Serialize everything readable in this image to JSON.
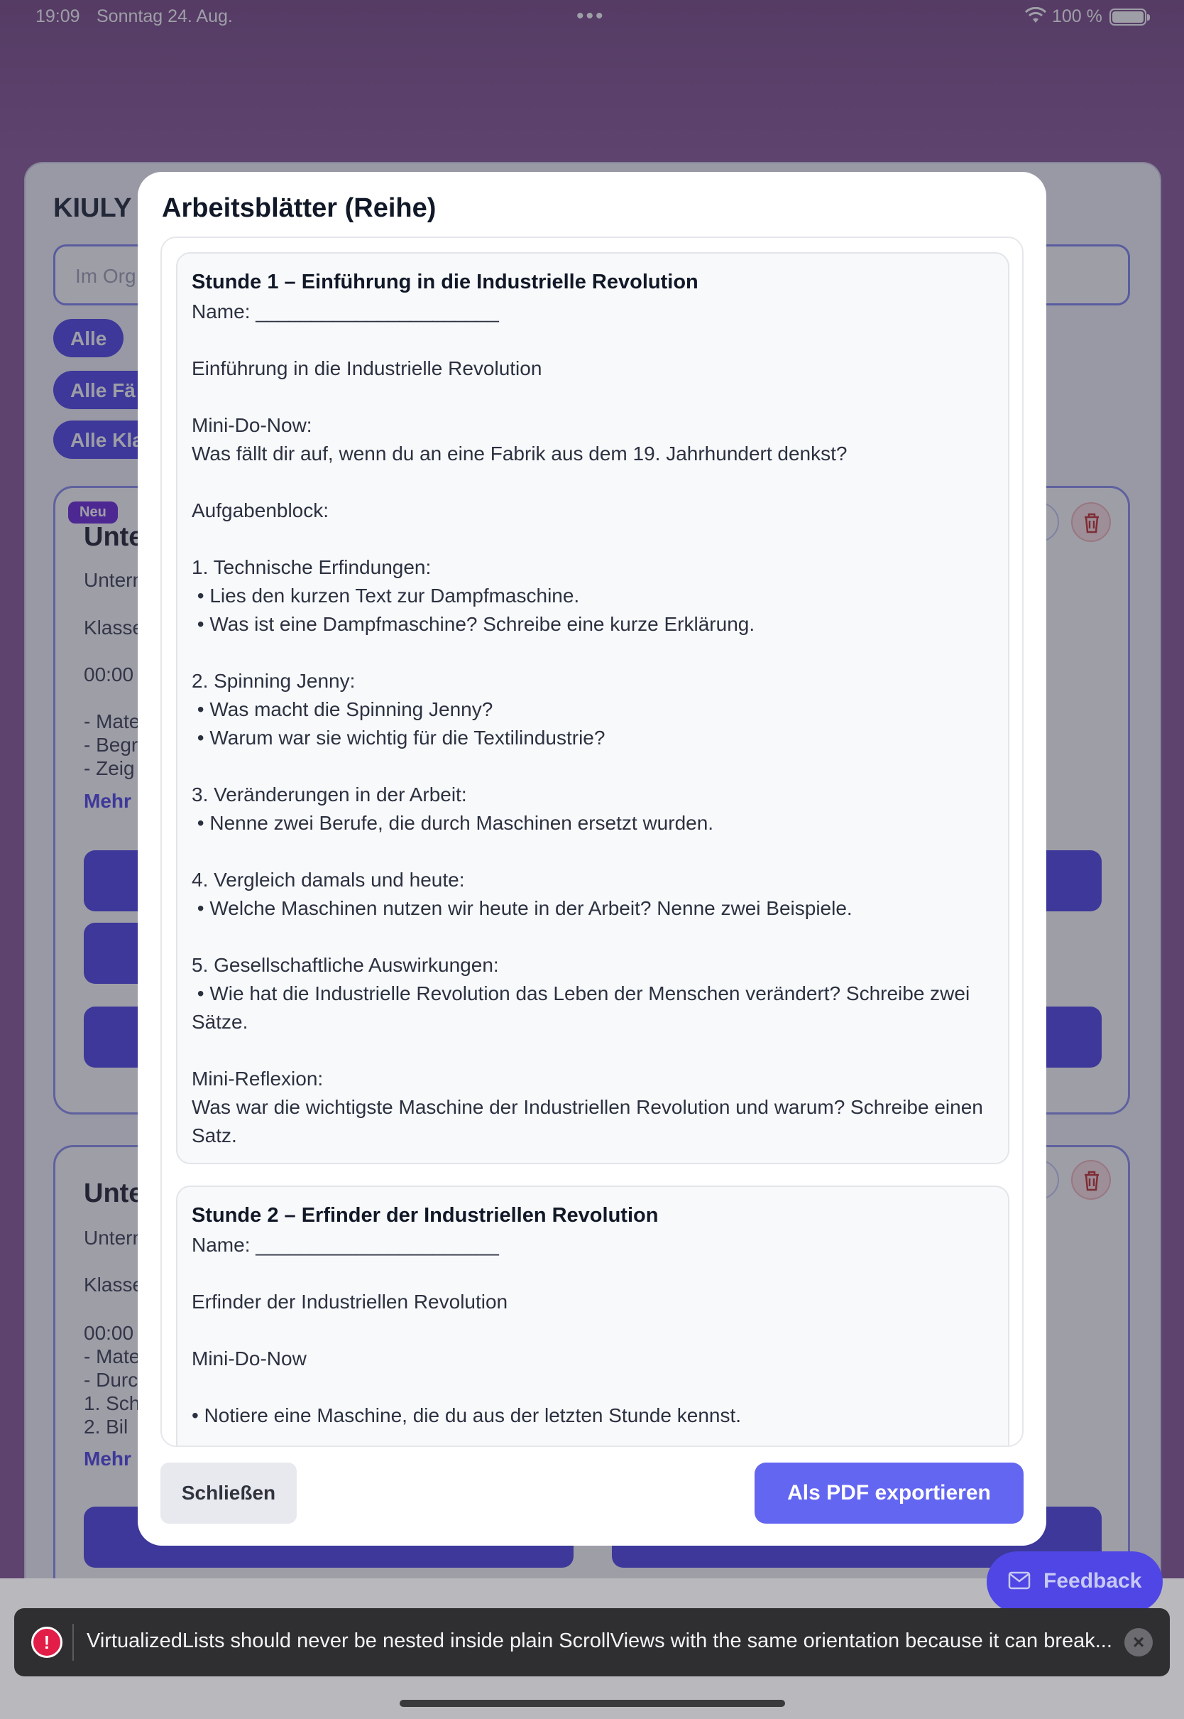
{
  "status_bar": {
    "time": "19:09",
    "date": "Sonntag 24. Aug.",
    "battery_pct": "100 %"
  },
  "background": {
    "app_title": "KIULY",
    "search_placeholder": "Im Org",
    "filters": [
      "Alle",
      "Alle Fä",
      "Alle Kla"
    ],
    "card1": {
      "badge": "Neu",
      "title": "Unte",
      "lines": [
        "Untern",
        "Klasse",
        "00:00",
        "- Mate",
        "- Begr",
        "- Zeig"
      ],
      "more": "Mehr"
    },
    "card2": {
      "title": "Unte",
      "lines": [
        "Untern",
        "Klasse",
        "00:00",
        "- Mate",
        "- Durc",
        " 1. Sch",
        " 2. Bil"
      ],
      "more": "Mehr"
    }
  },
  "modal": {
    "title": "Arbeitsblätter (Reihe)",
    "sheets": [
      {
        "title": "Stunde 1 – Einführung in die Industrielle Revolution",
        "body": "Name: ______________________\n\nEinführung in die Industrielle Revolution\n\nMini-Do-Now:\nWas fällt dir auf, wenn du an eine Fabrik aus dem 19. Jahrhundert denkst?\n\nAufgabenblock:\n\n1. Technische Erfindungen:\n • Lies den kurzen Text zur Dampfmaschine.\n • Was ist eine Dampfmaschine? Schreibe eine kurze Erklärung.\n\n2. Spinning Jenny:\n • Was macht die Spinning Jenny?\n • Warum war sie wichtig für die Textilindustrie?\n\n3. Veränderungen in der Arbeit:\n • Nenne zwei Berufe, die durch Maschinen ersetzt wurden.\n\n4. Vergleich damals und heute:\n • Welche Maschinen nutzen wir heute in der Arbeit? Nenne zwei Beispiele.\n\n5. Gesellschaftliche Auswirkungen:\n • Wie hat die Industrielle Revolution das Leben der Menschen verändert? Schreibe zwei Sätze.\n\nMini-Reflexion:\nWas war die wichtigste Maschine der Industriellen Revolution und warum? Schreibe einen Satz."
      },
      {
        "title": "Stunde 2 – Erfinder der Industriellen Revolution",
        "body": "Name: ______________________\n\nErfinder der Industriellen Revolution\n\nMini-Do-Now\n\n• Notiere eine Maschine, die du aus der letzten Stunde kennst."
      }
    ],
    "close_label": "Schließen",
    "export_label": "Als PDF exportieren"
  },
  "feedback_label": "Feedback",
  "toast_message": "VirtualizedLists should never be nested inside plain ScrollViews with the same orientation because it can break...",
  "icons": {
    "wifi": "wifi-icon",
    "battery": "battery-icon",
    "trash": "trash-icon",
    "mail": "mail-icon",
    "warning": "error-icon",
    "close": "close-icon"
  },
  "colors": {
    "accent": "#6366f1",
    "primary_button": "#4f46e5",
    "backdrop": "#8a5a97",
    "toast_bg": "#2f2f31",
    "error": "#e11d48"
  }
}
